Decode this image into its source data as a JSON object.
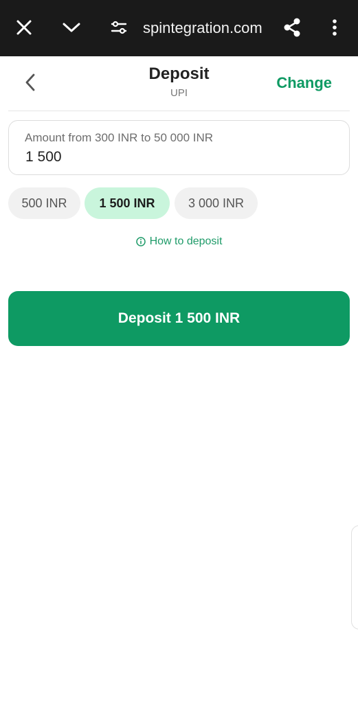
{
  "browser": {
    "url": "spintegration.com",
    "icons": [
      "close-icon",
      "chevron-down-icon",
      "site-settings-icon",
      "share-icon",
      "more-vertical-icon"
    ]
  },
  "header": {
    "title": "Deposit",
    "subtitle": "UPI",
    "change_label": "Change",
    "back_icon": "chevron-left-icon"
  },
  "amount": {
    "label": "Amount from 300 INR to 50 000 INR",
    "value": "1 500"
  },
  "presets": [
    {
      "label": "500 INR",
      "selected": false
    },
    {
      "label": "1 500 INR",
      "selected": true
    },
    {
      "label": "3 000 INR",
      "selected": false
    }
  ],
  "how_to": {
    "label": "How to deposit",
    "icon": "info-icon"
  },
  "deposit_button": {
    "label": "Deposit 1 500 INR"
  },
  "colors": {
    "accent": "#0e9a63",
    "selected_chip": "#c9f5dc",
    "browser_bar": "#1a1a1a"
  }
}
